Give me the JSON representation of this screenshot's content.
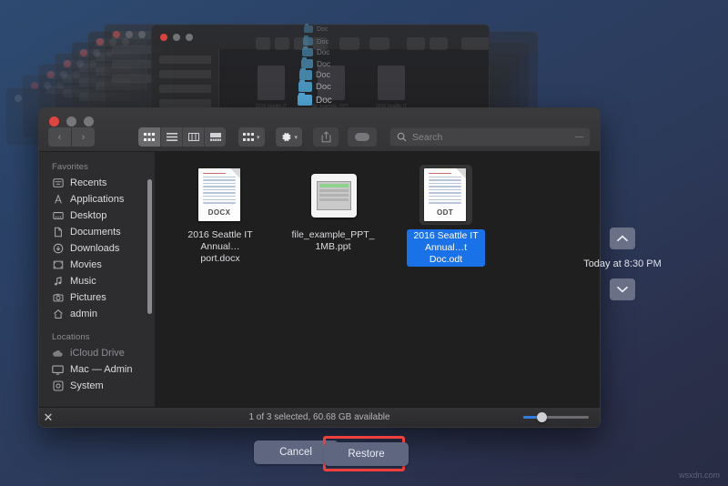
{
  "background": {
    "gradient_top": "#2e4a70",
    "gradient_bottom": "#282c44"
  },
  "cascade": {
    "doc_label": "Doc",
    "count": 9
  },
  "finder": {
    "traffic_lights": [
      "close",
      "minimize",
      "zoom"
    ],
    "nav": {
      "back": "‹",
      "forward": "›"
    },
    "toolbar": {
      "views": [
        {
          "name": "icon-view",
          "glyph": "∷",
          "active": true
        },
        {
          "name": "list-view",
          "glyph": "☰",
          "active": false
        },
        {
          "name": "column-view",
          "glyph": "‖",
          "active": false
        },
        {
          "name": "gallery-view",
          "glyph": "▤",
          "active": false
        }
      ],
      "group_by": {
        "glyph": "∷",
        "chevron": "▾"
      },
      "action_menu": {
        "glyph": "⚙",
        "chevron": "▾"
      },
      "share": {
        "glyph": "⇧"
      },
      "tags": {
        "glyph": "oval"
      },
      "search": {
        "placeholder": "Search",
        "value": "",
        "icon": "search-icon"
      }
    },
    "sidebar": {
      "sections": [
        {
          "title": "Favorites",
          "items": [
            {
              "label": "Recents",
              "icon": "clock-icon",
              "dim": false
            },
            {
              "label": "Applications",
              "icon": "applications-icon",
              "dim": false
            },
            {
              "label": "Desktop",
              "icon": "desktop-icon",
              "dim": false
            },
            {
              "label": "Documents",
              "icon": "documents-icon",
              "dim": false
            },
            {
              "label": "Downloads",
              "icon": "downloads-icon",
              "dim": false
            },
            {
              "label": "Movies",
              "icon": "movies-icon",
              "dim": false
            },
            {
              "label": "Music",
              "icon": "music-icon",
              "dim": false
            },
            {
              "label": "Pictures",
              "icon": "pictures-icon",
              "dim": false
            },
            {
              "label": "admin",
              "icon": "home-icon",
              "dim": false
            }
          ]
        },
        {
          "title": "Locations",
          "items": [
            {
              "label": "iCloud Drive",
              "icon": "icloud-icon",
              "dim": true
            },
            {
              "label": "Mac — Admin",
              "icon": "display-icon",
              "dim": false
            },
            {
              "label": "System",
              "icon": "disk-icon",
              "dim": false
            }
          ]
        }
      ]
    },
    "files": [
      {
        "name": "2016 Seattle IT\nAnnual…port.docx",
        "line1": "2016 Seattle IT",
        "line2": "Annual…port.docx",
        "type": "docx",
        "ext_badge": "DOCX",
        "selected": false
      },
      {
        "name": "file_example_PPT_\n1MB.ppt",
        "line1": "file_example_PPT_",
        "line2": "1MB.ppt",
        "type": "ppt",
        "ext_badge": "",
        "selected": false
      },
      {
        "name": "2016 Seattle IT\nAnnual…t Doc.odt",
        "line1": "2016 Seattle IT",
        "line2": "Annual…t Doc.odt",
        "type": "odt",
        "ext_badge": "ODT",
        "selected": true
      }
    ],
    "status": {
      "text": "1 of 3 selected, 60.68 GB available",
      "zoom_slider_value": 22
    },
    "close_icon": "✕"
  },
  "timeline": {
    "up_button": "⌃",
    "down_button": "⌄",
    "date_label": "Today at 8:30 PM"
  },
  "actions": {
    "cancel_label": "Cancel",
    "restore_label": "Restore",
    "highlight_color": "#f0403c"
  },
  "watermark": "wsxdn.com"
}
